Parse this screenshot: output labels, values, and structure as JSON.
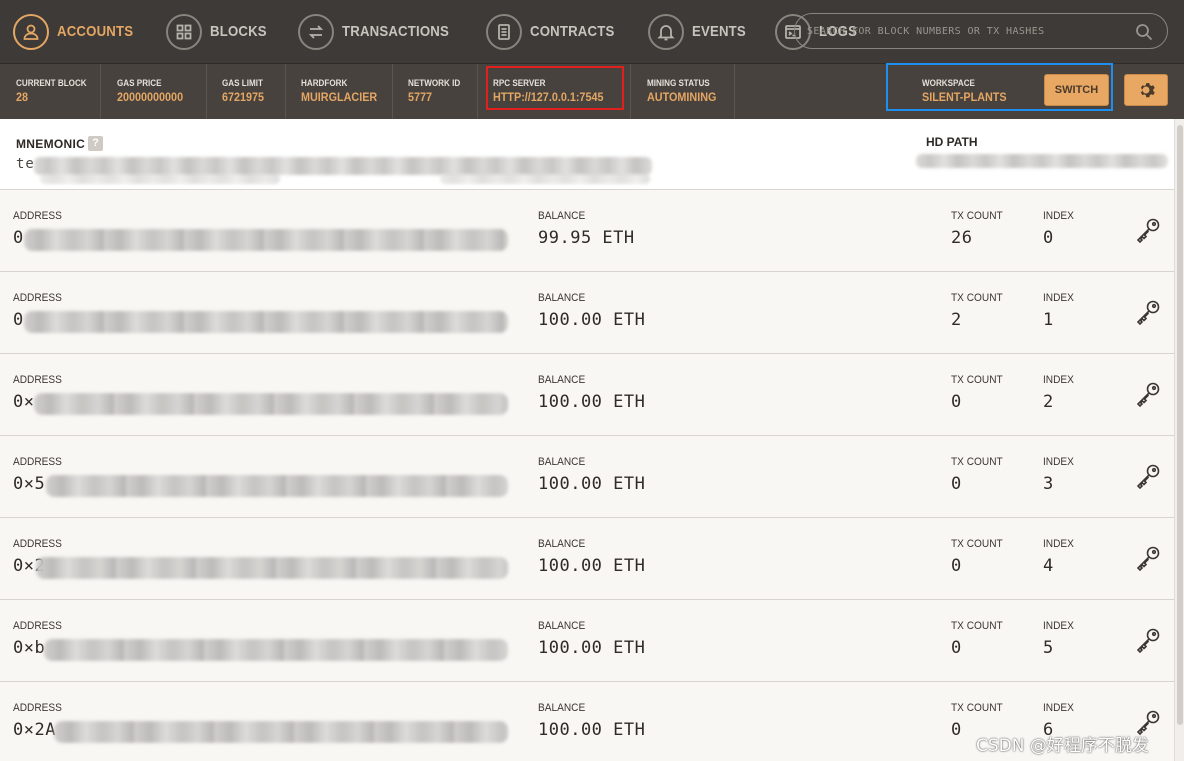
{
  "nav": {
    "items": [
      {
        "label": "ACCOUNTS",
        "icon": "person-icon",
        "active": true
      },
      {
        "label": "BLOCKS",
        "icon": "grid-icon",
        "active": false
      },
      {
        "label": "TRANSACTIONS",
        "icon": "swap-icon",
        "active": false
      },
      {
        "label": "CONTRACTS",
        "icon": "document-icon",
        "active": false
      },
      {
        "label": "EVENTS",
        "icon": "bell-icon",
        "active": false
      },
      {
        "label": "LOGS",
        "icon": "terminal-icon",
        "active": false
      }
    ],
    "search_placeholder": "SEARCH FOR BLOCK NUMBERS OR TX HASHES"
  },
  "status": {
    "current_block": {
      "label": "CURRENT BLOCK",
      "value": "28"
    },
    "gas_price": {
      "label": "GAS PRICE",
      "value": "20000000000"
    },
    "gas_limit": {
      "label": "GAS LIMIT",
      "value": "6721975"
    },
    "hardfork": {
      "label": "HARDFORK",
      "value": "MUIRGLACIER"
    },
    "network_id": {
      "label": "NETWORK ID",
      "value": "5777"
    },
    "rpc_server": {
      "label": "RPC SERVER",
      "value": "HTTP://127.0.0.1:7545"
    },
    "mining_status": {
      "label": "MINING STATUS",
      "value": "AUTOMINING"
    },
    "workspace": {
      "label": "WORKSPACE",
      "value": "SILENT-PLANTS"
    },
    "switch_label": "SWITCH"
  },
  "mnemonic": {
    "label": "MNEMONIC",
    "help": "?",
    "value_visible": "te",
    "hd_path_label": "HD PATH"
  },
  "accounts": {
    "address_label": "ADDRESS",
    "balance_label": "BALANCE",
    "tx_count_label": "TX COUNT",
    "index_label": "INDEX",
    "rows": [
      {
        "address_prefix": "0",
        "balance": "99.95 ETH",
        "tx_count": "26",
        "index": "0"
      },
      {
        "address_prefix": "0",
        "balance": "100.00 ETH",
        "tx_count": "2",
        "index": "1"
      },
      {
        "address_prefix": "0×",
        "balance": "100.00 ETH",
        "tx_count": "0",
        "index": "2"
      },
      {
        "address_prefix": "0×5",
        "balance": "100.00 ETH",
        "tx_count": "0",
        "index": "3"
      },
      {
        "address_prefix": "0×2",
        "balance": "100.00 ETH",
        "tx_count": "0",
        "index": "4"
      },
      {
        "address_prefix": "0×b",
        "balance": "100.00 ETH",
        "tx_count": "0",
        "index": "5"
      },
      {
        "address_prefix": "0×2A",
        "balance": "100.00 ETH",
        "tx_count": "0",
        "index": "6"
      }
    ]
  },
  "watermark": "CSDN @好程序不脱发",
  "colors": {
    "accent": "#e4a663",
    "nav_bg": "#3e3a37",
    "status_bg": "#47423e",
    "highlight_red": "#e0201c",
    "highlight_blue": "#1e8ff0"
  }
}
